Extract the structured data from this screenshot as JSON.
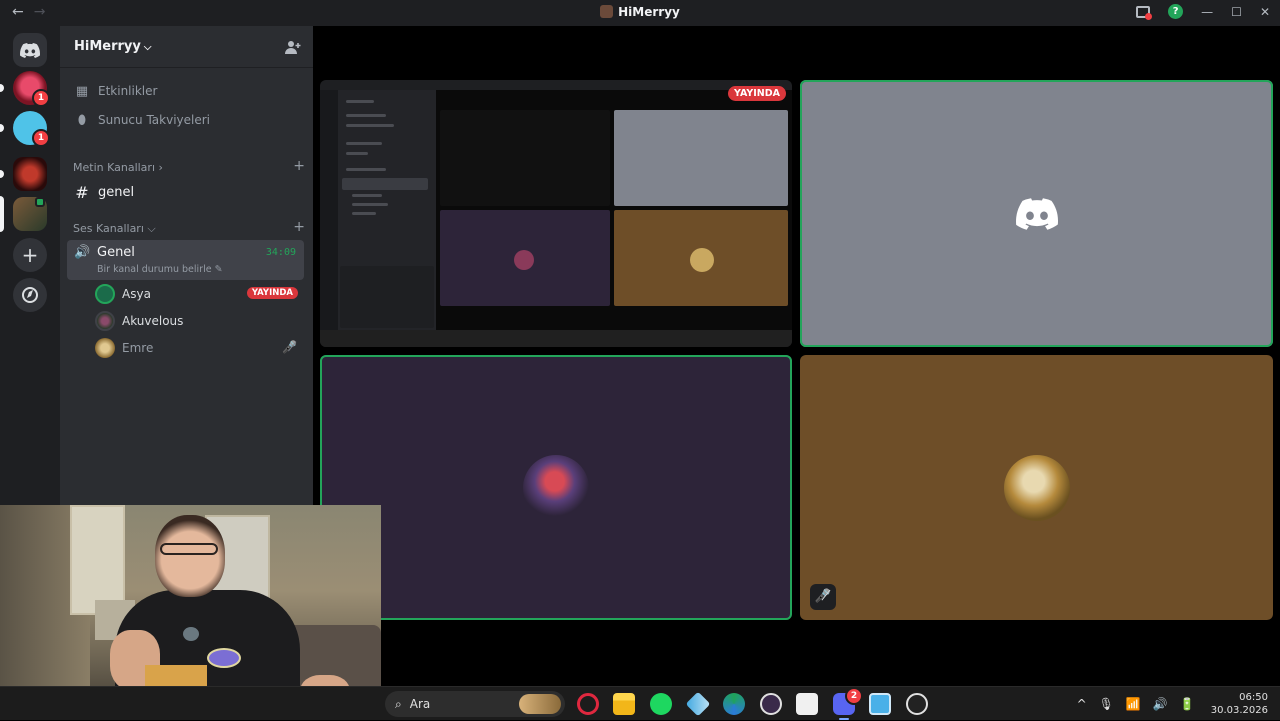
{
  "window": {
    "title": "HiMerryy",
    "back_glyph": "←",
    "forward_glyph": "→",
    "help_glyph": "?",
    "min_glyph": "—",
    "max_glyph": "☐",
    "close_glyph": "✕"
  },
  "rail": {
    "badges": [
      "1",
      "1"
    ],
    "add_glyph": "+"
  },
  "server": {
    "name": "HiMerryy",
    "chevron": "⌵"
  },
  "menu": [
    {
      "label": "Etkinlikler",
      "icon": "calendar-icon"
    },
    {
      "label": "Sunucu Takviyeleri",
      "icon": "boost-icon"
    }
  ],
  "text_category": {
    "label": "Metin Kanalları ›",
    "plus": "+"
  },
  "text_channels": [
    {
      "label": "genel",
      "glyph": "#"
    }
  ],
  "voice_category": {
    "label": "Ses Kanalları ⌵",
    "plus": "+"
  },
  "voice_channel": {
    "name": "Genel",
    "timer": "34:09",
    "status": "Bir kanal durumu belirle ✎",
    "speaker_glyph": "🔊"
  },
  "voice_users": [
    {
      "name": "Asya",
      "badge": "YAYINDA"
    },
    {
      "name": "Akuvelous",
      "badge": ""
    },
    {
      "name": "Emre",
      "badge": ""
    }
  ],
  "muted_glyph": "🎤̸",
  "stage": {
    "live_badge": "YAYINDA"
  },
  "taskbar": {
    "search_placeholder": "Ara",
    "search_glyph": "⌕",
    "discord_badge": "2",
    "time": "06:50",
    "date": "30.03.2026",
    "tray_up": "^",
    "tray_mic": "🎙",
    "tray_wifi": "📶",
    "tray_vol": "🔊",
    "tray_bat": "🔋"
  },
  "colors": {
    "live_red": "#da373c",
    "speaking_green": "#23a55a",
    "sidebar_bg": "#2b2d31",
    "rail_bg": "#1e1f22"
  }
}
